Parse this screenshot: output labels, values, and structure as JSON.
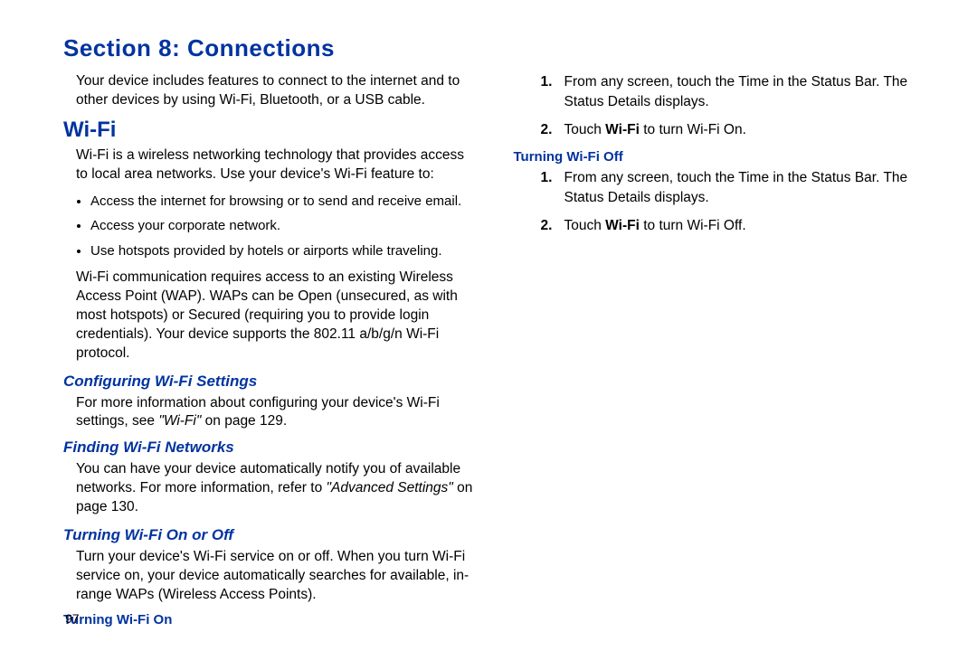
{
  "section_title": "Section 8: Connections",
  "intro": "Your device includes features to connect to the internet and to other devices by using Wi-Fi, Bluetooth, or a USB cable.",
  "wifi_heading": "Wi-Fi",
  "wifi_intro": "Wi-Fi is a wireless networking technology that provides access to local area networks. Use your device's Wi-Fi feature to:",
  "wifi_bullets": [
    "Access the internet for browsing or to send and receive email.",
    "Access your corporate network.",
    "Use hotspots provided by hotels or airports while traveling."
  ],
  "wifi_detail": "Wi-Fi communication requires access to an existing Wireless Access Point (WAP). WAPs can be Open (unsecured, as with most hotspots) or Secured (requiring you to provide login credentials). Your device supports the 802.11 a/b/g/n Wi-Fi protocol.",
  "configuring_heading": "Configuring Wi-Fi Settings",
  "configuring_text_a": "For more information about configuring your device's Wi-Fi settings, see ",
  "configuring_ref": "\"Wi-Fi\"",
  "configuring_text_b": " on page 129.",
  "finding_heading": "Finding Wi-Fi Networks",
  "finding_text_a": "You can have your device automatically notify you of available networks. For more information, refer to ",
  "finding_ref": "\"Advanced Settings\"",
  "finding_text_b": " on page 130.",
  "turning_heading": "Turning Wi-Fi On or Off",
  "turning_text": "Turn your device's Wi-Fi service on or off. When you turn Wi-Fi service on, your device automatically searches for available, in-range WAPs (Wireless Access Points).",
  "on_heading": "Turning Wi-Fi On",
  "on_steps": [
    {
      "n": "1.",
      "a": "From any screen, touch the Time in the Status Bar. The Status Details displays."
    },
    {
      "n": "2.",
      "a": "Touch ",
      "bold": "Wi-Fi",
      "b": " to turn Wi-Fi On."
    }
  ],
  "off_heading": "Turning Wi-Fi Off",
  "off_steps": [
    {
      "n": "1.",
      "a": "From any screen, touch the Time in the Status Bar. The Status Details displays."
    },
    {
      "n": "2.",
      "a": "Touch ",
      "bold": "Wi-Fi",
      "b": " to turn Wi-Fi Off."
    }
  ],
  "page_number": "97"
}
